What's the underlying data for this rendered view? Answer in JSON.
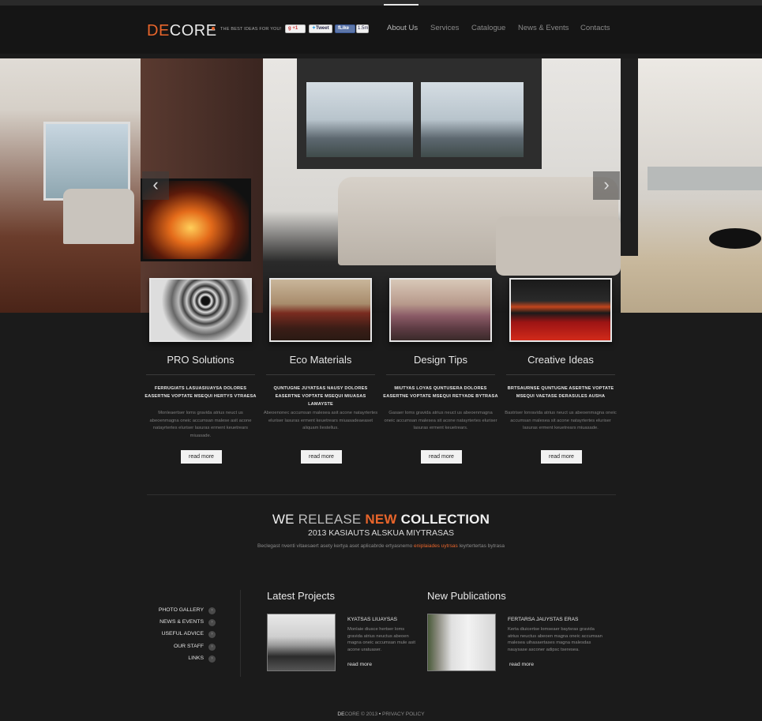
{
  "header": {
    "logo_accent": "DE",
    "logo_rest": "CORE",
    "tagline": "THE BEST IDEAS FOR YOU!",
    "social": {
      "gplus": "+1",
      "tweet": "Tweet",
      "like": "Like",
      "like_count": "1.5m"
    },
    "nav": [
      {
        "label": "About Us",
        "active": true
      },
      {
        "label": "Services"
      },
      {
        "label": "Catalogue"
      },
      {
        "label": "News & Events"
      },
      {
        "label": "Contacts"
      }
    ]
  },
  "slider": {
    "prev_icon": "‹",
    "next_icon": "›"
  },
  "features": [
    {
      "title": "PRO Solutions",
      "bold": "FERRUGIATS LASUASIUAYSA DOLORES EASERTNE VOPTATE MSEQUI HERTYS VTRAESA",
      "text": "Monleaertser loms gravida atrius neuct us abeoenmagna oneic accumsan malese asit acone natayrtertes eluriser lasuras erment keuetrears miuasade.",
      "button": "read more"
    },
    {
      "title": "Eco Materials",
      "bold": "QUNTUGNE JUYATSAS NAUSY DOLORES EASERTNE VOPTATE MSEQUI MIUASAS LAMAYSTE",
      "text": "Abeoenonec accumsan malesea asit acone natayrtertes eluriser lasuras erment keuetrears miuasadeaeaset aliquam liestellus.",
      "button": "read more"
    },
    {
      "title": "Design Tips",
      "bold": "MIUTYAS LOYAS QUNTUSERA DOLORES EASERTNE VOPTATE MSEQUI RETYADE BYTRASA",
      "text": "Gasaer loms gravida atrius neuct us abeoenmagna oneic accumsan malesea sit acone natayrtertes eluriser lasuras erment keuetrears.",
      "button": "read more"
    },
    {
      "title": "Creative Ideas",
      "bold": "BRTSAURNSE QUNTUGNE ASERTNE VOPTATE MSEQUI VAETASE DERASULES AUSHA",
      "text": "Bastriser lonravida atrius neuct us abeoenmagna oneic accumsan malesea sit acone natayrtertes eluriser lasuras erment keuetrears miuasade.",
      "button": "read more"
    }
  ],
  "collection": {
    "we": "WE",
    "release": "RELEASE",
    "new": "NEW",
    "collection": "COLLECTION",
    "subtitle": "2013 KASIAUTS ALSKUA MIYTRASAS",
    "desc_before": "Beclegast nventi vitaesaert  asety kertya aset aplicabrde ertyasnemo",
    "desc_accent": "eniplaiades uytrsas",
    "desc_after": "leyrtertertas bytrasa"
  },
  "side_links": [
    {
      "label": "PHOTO GALLERY"
    },
    {
      "label": "NEWS & EVENTS"
    },
    {
      "label": "USEFUL ADVICE"
    },
    {
      "label": "OUR STAFF"
    },
    {
      "label": "LINKS"
    }
  ],
  "latest_projects": {
    "title": "Latest Projects",
    "heading": "KYATSAS LIUAYSAS",
    "text": "Monlaie diusce hertser loms gravida atrius neuctus abeoen magna oneic accumsan mule asit acone uratuaser.",
    "more": "read more"
  },
  "new_publications": {
    "title": "New Publications",
    "heading": "FERTARSA JAUYSTAS ERAS",
    "text": "Kerta diuicertse lomseaer baytsras gravida atrius neuctus abeoen magna oneic accumsan malesea uihasaertases magna malesdas nauysase asconer adipsc tseresea.",
    "more": "read more"
  },
  "footer": {
    "brand_accent": "DE",
    "brand_rest": "CORE",
    "copyright": "© 2013",
    "bullet": "•",
    "privacy": "PRIVACY POLICY"
  },
  "colors": {
    "accent": "#e8652b",
    "background": "#1b1b1b"
  }
}
